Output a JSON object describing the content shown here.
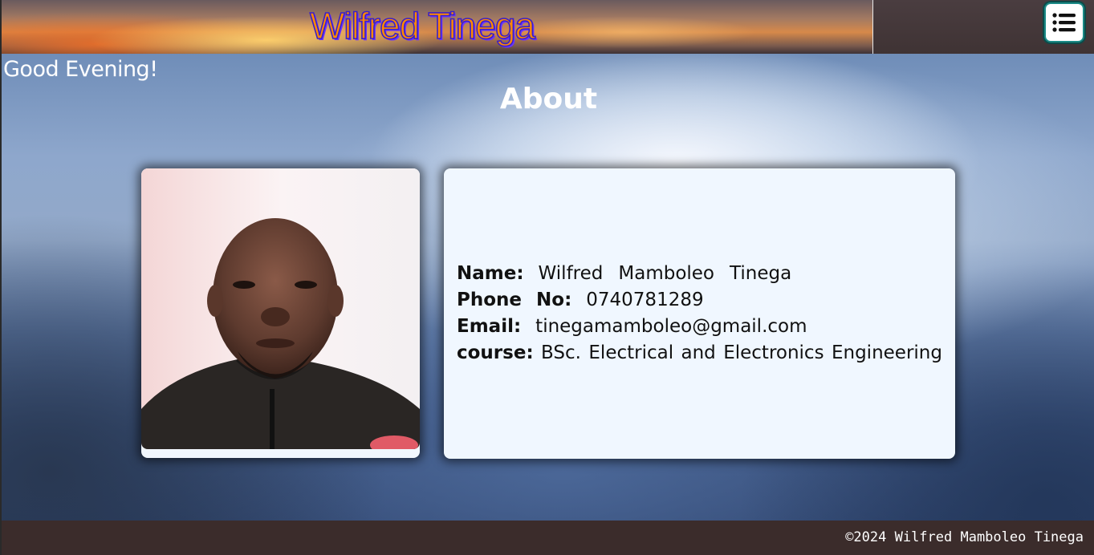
{
  "header": {
    "site_title": "Wilfred Tinega",
    "menu_icon": "list-icon"
  },
  "greeting": "Good Evening!",
  "about": {
    "title": "About",
    "photo_alt": "Wilfred Tinega",
    "details": {
      "name_label": "Name:",
      "name_words": [
        "Wilfred",
        "Mamboleo",
        "Tinega"
      ],
      "phone_label_words": [
        "Phone",
        "No:"
      ],
      "phone": "0740781289",
      "email_label": "Email:",
      "email": "tinegamamboleo@gmail.com",
      "course_label": "course:",
      "course_words": [
        "BSc.",
        "Electrical",
        "and",
        "Electronics",
        "Engineering"
      ]
    }
  },
  "footer": {
    "copyright": "©2024 Wilfred Mamboleo Tinega"
  },
  "colors": {
    "header_bg": "#3f3334",
    "title_fill": "#ff8a00",
    "title_stroke": "#3a1fc8",
    "card_bg": "#f0f7ff",
    "footer_bg": "#3b2c2b",
    "menu_border": "#1b8a86"
  }
}
